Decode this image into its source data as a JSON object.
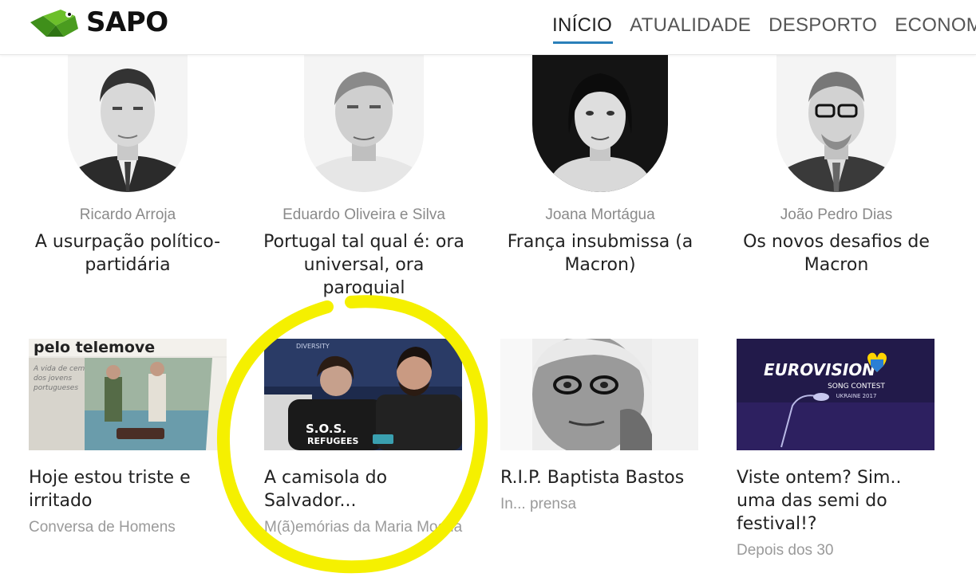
{
  "header": {
    "logo_text": "SAPO",
    "nav": [
      "INÍCIO",
      "ATUALIDADE",
      "DESPORTO",
      "ECONOMI"
    ]
  },
  "opinions": [
    {
      "author": "Ricardo Arroja",
      "title": "A usurpação político-partidária"
    },
    {
      "author": "Eduardo Oliveira e Silva",
      "title": "Portugal tal qual é: ora universal, ora paroquial"
    },
    {
      "author": "Joana Mortágua",
      "title": "França insubmissa (a Macron)"
    },
    {
      "author": "João Pedro Dias",
      "title": "Os novos desafios de Macron"
    }
  ],
  "cards": [
    {
      "title": "Hoje estou triste e irritado",
      "source": "Conversa de Homens",
      "thumb_text": [
        "pelo telemove",
        "A vida de cem",
        "dos jovens",
        "portugueses"
      ]
    },
    {
      "title": "A camisola do Salvador...",
      "source": "M(ã)emórias da Maria Mocha",
      "thumb_text": [
        "DIVERSITY",
        "S.O.S.",
        "REFUGEES"
      ]
    },
    {
      "title": "R.I.P. Baptista Bastos",
      "source": "In... prensa"
    },
    {
      "title": "Viste ontem? Sim.. uma das semi do festival!?",
      "source": "Depois dos 30",
      "thumb_text": [
        "EUROVISION",
        "SONG CONTEST",
        "UKRAINE 2017"
      ]
    }
  ],
  "colors": {
    "accent": "#2a80b9",
    "logo_green": "#5aa51e",
    "highlight": "#f5f000"
  }
}
